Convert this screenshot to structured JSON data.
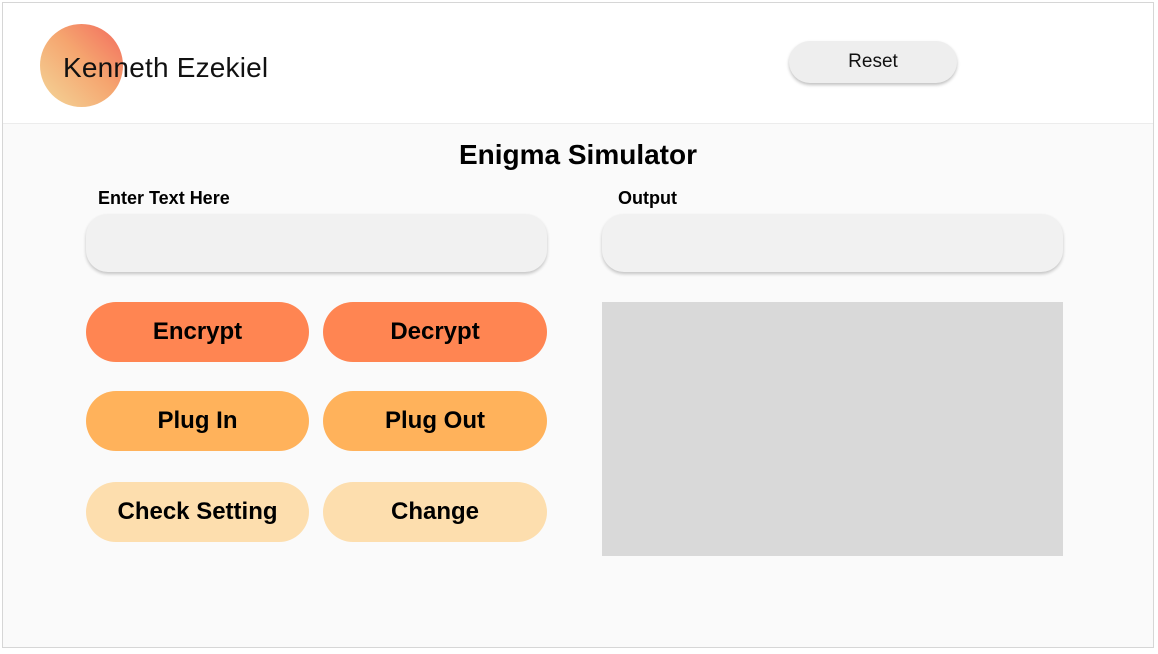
{
  "header": {
    "user_name": "Kenneth Ezekiel",
    "reset_label": "Reset"
  },
  "main": {
    "title": "Enigma Simulator",
    "input": {
      "label": "Enter Text Here",
      "value": "",
      "placeholder": ""
    },
    "output": {
      "label": "Output",
      "value": "",
      "placeholder": ""
    },
    "buttons": {
      "encrypt": "Encrypt",
      "decrypt": "Decrypt",
      "plug_in": "Plug In",
      "plug_out": "Plug Out",
      "check_setting": "Check Setting",
      "change": "Change"
    }
  },
  "colors": {
    "avatar_gradient": [
      "#f4d79a",
      "#f5a56f",
      "#f26a5d"
    ],
    "primary_action": "#ff8552",
    "plug_action": "#ffb25b",
    "setting_action": "#fddeae",
    "panel": "#d9d9d9",
    "field": "#f1f1f1",
    "background": "#fafafa"
  }
}
